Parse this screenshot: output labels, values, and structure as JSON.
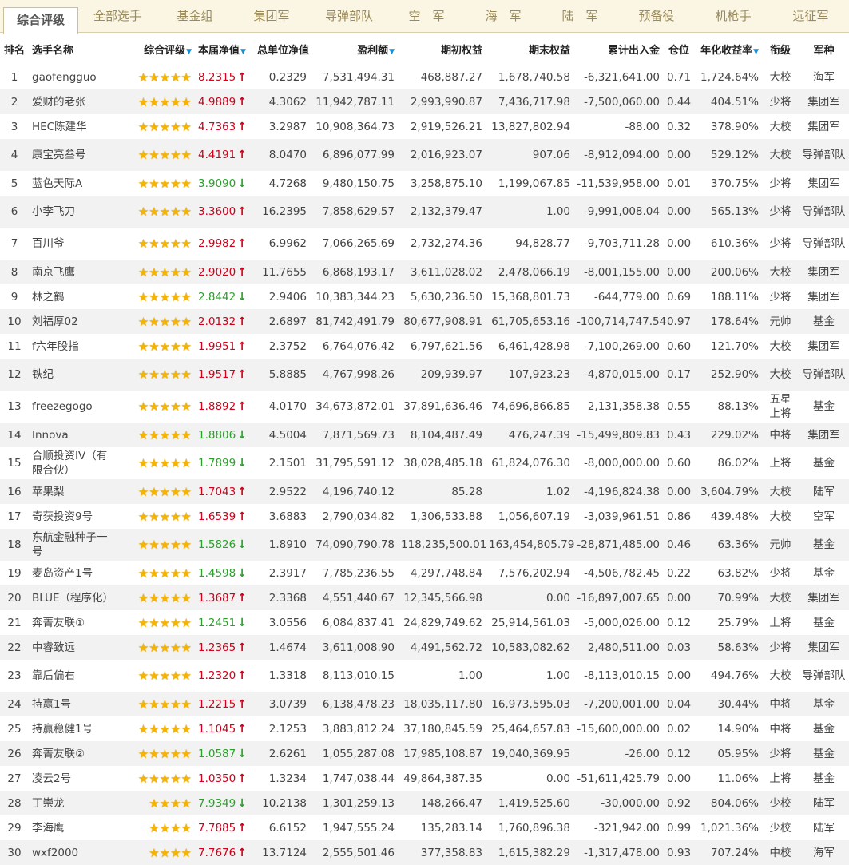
{
  "tabs": [
    "综合评级",
    "全部选手",
    "基金组",
    "集团军",
    "导弹部队",
    "空　军",
    "海　军",
    "陆　军",
    "预备役",
    "机枪手",
    "远征军"
  ],
  "active_tab": 0,
  "colors": {
    "up": "#d0021b",
    "down": "#2ca02c",
    "star": "#f5b400",
    "sort": "#1a8fd0"
  },
  "headers": [
    "排名",
    "选手名称",
    "综合评级",
    "本届净值",
    "总单位净值",
    "盈利额",
    "期初权益",
    "期末权益",
    "累计出入金",
    "仓位",
    "年化收益率",
    "衔级",
    "军种"
  ],
  "sort_indicator": "▼",
  "rows": [
    {
      "rank": "1",
      "name": "gaofengguo",
      "stars": 5,
      "nav": "8.2315",
      "dir": "up",
      "unit": "0.2329",
      "profit": "7,531,494.31",
      "start": "468,887.27",
      "end": "1,678,740.58",
      "flow": "-6,321,641.00",
      "pos": "0.71",
      "ann": "1,724.64%",
      "rankname": "大校",
      "branch": "海军"
    },
    {
      "rank": "2",
      "name": "爱财的老张",
      "stars": 5,
      "nav": "4.9889",
      "dir": "up",
      "unit": "4.3062",
      "profit": "11,942,787.11",
      "start": "2,993,990.87",
      "end": "7,436,717.98",
      "flow": "-7,500,060.00",
      "pos": "0.44",
      "ann": "404.51%",
      "rankname": "少将",
      "branch": "集团军"
    },
    {
      "rank": "3",
      "name": "HEC陈建华",
      "stars": 5,
      "nav": "4.7363",
      "dir": "up",
      "unit": "3.2987",
      "profit": "10,908,364.73",
      "start": "2,919,526.21",
      "end": "13,827,802.94",
      "flow": "-88.00",
      "pos": "0.32",
      "ann": "378.90%",
      "rankname": "大校",
      "branch": "集团军"
    },
    {
      "rank": "4",
      "name": "康宝亮叁号",
      "stars": 5,
      "nav": "4.4191",
      "dir": "up",
      "unit": "8.0470",
      "profit": "6,896,077.99",
      "start": "2,016,923.07",
      "end": "907.06",
      "flow": "-8,912,094.00",
      "pos": "0.00",
      "ann": "529.12%",
      "rankname": "大校",
      "branch": "导弹部队"
    },
    {
      "rank": "5",
      "name": "蓝色天际A",
      "stars": 5,
      "nav": "3.9090",
      "dir": "down",
      "unit": "4.7268",
      "profit": "9,480,150.75",
      "start": "3,258,875.10",
      "end": "1,199,067.85",
      "flow": "-11,539,958.00",
      "pos": "0.01",
      "ann": "370.75%",
      "rankname": "少将",
      "branch": "集团军"
    },
    {
      "rank": "6",
      "name": "小李飞刀",
      "stars": 5,
      "nav": "3.3600",
      "dir": "up",
      "unit": "16.2395",
      "profit": "7,858,629.57",
      "start": "2,132,379.47",
      "end": "1.00",
      "flow": "-9,991,008.04",
      "pos": "0.00",
      "ann": "565.13%",
      "rankname": "少将",
      "branch": "导弹部队"
    },
    {
      "rank": "7",
      "name": "百川爷",
      "stars": 5,
      "nav": "2.9982",
      "dir": "up",
      "unit": "6.9962",
      "profit": "7,066,265.69",
      "start": "2,732,274.36",
      "end": "94,828.77",
      "flow": "-9,703,711.28",
      "pos": "0.00",
      "ann": "610.36%",
      "rankname": "少将",
      "branch": "导弹部队"
    },
    {
      "rank": "8",
      "name": "南京飞鹰",
      "stars": 5,
      "nav": "2.9020",
      "dir": "up",
      "unit": "11.7655",
      "profit": "6,868,193.17",
      "start": "3,611,028.02",
      "end": "2,478,066.19",
      "flow": "-8,001,155.00",
      "pos": "0.00",
      "ann": "200.06%",
      "rankname": "大校",
      "branch": "集团军"
    },
    {
      "rank": "9",
      "name": "林之鹤",
      "stars": 5,
      "nav": "2.8442",
      "dir": "down",
      "unit": "2.9406",
      "profit": "10,383,344.23",
      "start": "5,630,236.50",
      "end": "15,368,801.73",
      "flow": "-644,779.00",
      "pos": "0.69",
      "ann": "188.11%",
      "rankname": "少将",
      "branch": "集团军"
    },
    {
      "rank": "10",
      "name": "刘福厚02",
      "stars": 5,
      "nav": "2.0132",
      "dir": "up",
      "unit": "2.6897",
      "profit": "81,742,491.79",
      "start": "80,677,908.91",
      "end": "61,705,653.16",
      "flow": "-100,714,747.54",
      "pos": "0.97",
      "ann": "178.64%",
      "rankname": "元帅",
      "branch": "基金"
    },
    {
      "rank": "11",
      "name": "f六年股指",
      "stars": 5,
      "nav": "1.9951",
      "dir": "up",
      "unit": "2.3752",
      "profit": "6,764,076.42",
      "start": "6,797,621.56",
      "end": "6,461,428.98",
      "flow": "-7,100,269.00",
      "pos": "0.60",
      "ann": "121.70%",
      "rankname": "大校",
      "branch": "集团军"
    },
    {
      "rank": "12",
      "name": "铁纪",
      "stars": 5,
      "nav": "1.9517",
      "dir": "up",
      "unit": "5.8885",
      "profit": "4,767,998.26",
      "start": "209,939.97",
      "end": "107,923.23",
      "flow": "-4,870,015.00",
      "pos": "0.17",
      "ann": "252.90%",
      "rankname": "大校",
      "branch": "导弹部队"
    },
    {
      "rank": "13",
      "name": "freezegogo",
      "stars": 5,
      "nav": "1.8892",
      "dir": "up",
      "unit": "4.0170",
      "profit": "34,673,872.01",
      "start": "37,891,636.46",
      "end": "74,696,866.85",
      "flow": "2,131,358.38",
      "pos": "0.55",
      "ann": "88.13%",
      "rankname": "五星上将",
      "branch": "基金"
    },
    {
      "rank": "14",
      "name": "Innova",
      "stars": 5,
      "nav": "1.8806",
      "dir": "down",
      "unit": "4.5004",
      "profit": "7,871,569.73",
      "start": "8,104,487.49",
      "end": "476,247.39",
      "flow": "-15,499,809.83",
      "pos": "0.43",
      "ann": "229.02%",
      "rankname": "中将",
      "branch": "集团军"
    },
    {
      "rank": "15",
      "name": "合顺投资IV（有限合伙）",
      "stars": 5,
      "nav": "1.7899",
      "dir": "down",
      "unit": "2.1501",
      "profit": "31,795,591.12",
      "start": "38,028,485.18",
      "end": "61,824,076.30",
      "flow": "-8,000,000.00",
      "pos": "0.60",
      "ann": "86.02%",
      "rankname": "上将",
      "branch": "基金"
    },
    {
      "rank": "16",
      "name": "苹果梨",
      "stars": 5,
      "nav": "1.7043",
      "dir": "up",
      "unit": "2.9522",
      "profit": "4,196,740.12",
      "start": "85.28",
      "end": "1.02",
      "flow": "-4,196,824.38",
      "pos": "0.00",
      "ann": "3,604.79%",
      "rankname": "大校",
      "branch": "陆军"
    },
    {
      "rank": "17",
      "name": "奇获投资9号",
      "stars": 5,
      "nav": "1.6539",
      "dir": "up",
      "unit": "3.6883",
      "profit": "2,790,034.82",
      "start": "1,306,533.88",
      "end": "1,056,607.19",
      "flow": "-3,039,961.51",
      "pos": "0.86",
      "ann": "439.48%",
      "rankname": "大校",
      "branch": "空军"
    },
    {
      "rank": "18",
      "name": "东航金融种子一号",
      "stars": 5,
      "nav": "1.5826",
      "dir": "down",
      "unit": "1.8910",
      "profit": "74,090,790.78",
      "start": "118,235,500.01",
      "end": "163,454,805.79",
      "flow": "-28,871,485.00",
      "pos": "0.46",
      "ann": "63.36%",
      "rankname": "元帅",
      "branch": "基金"
    },
    {
      "rank": "19",
      "name": "麦岛资产1号",
      "stars": 5,
      "nav": "1.4598",
      "dir": "down",
      "unit": "2.3917",
      "profit": "7,785,236.55",
      "start": "4,297,748.84",
      "end": "7,576,202.94",
      "flow": "-4,506,782.45",
      "pos": "0.22",
      "ann": "63.82%",
      "rankname": "少将",
      "branch": "基金"
    },
    {
      "rank": "20",
      "name": "BLUE（程序化）",
      "stars": 5,
      "nav": "1.3687",
      "dir": "up",
      "unit": "2.3368",
      "profit": "4,551,440.67",
      "start": "12,345,566.98",
      "end": "0.00",
      "flow": "-16,897,007.65",
      "pos": "0.00",
      "ann": "70.99%",
      "rankname": "大校",
      "branch": "集团军"
    },
    {
      "rank": "21",
      "name": "奔菁友联①",
      "stars": 5,
      "nav": "1.2451",
      "dir": "down",
      "unit": "3.0556",
      "profit": "6,084,837.41",
      "start": "24,829,749.62",
      "end": "25,914,561.03",
      "flow": "-5,000,026.00",
      "pos": "0.12",
      "ann": "25.79%",
      "rankname": "上将",
      "branch": "基金"
    },
    {
      "rank": "22",
      "name": "中睿致远",
      "stars": 5,
      "nav": "1.2365",
      "dir": "up",
      "unit": "1.4674",
      "profit": "3,611,008.90",
      "start": "4,491,562.72",
      "end": "10,583,082.62",
      "flow": "2,480,511.00",
      "pos": "0.03",
      "ann": "58.63%",
      "rankname": "少将",
      "branch": "集团军"
    },
    {
      "rank": "23",
      "name": "靠后偏右",
      "stars": 5,
      "nav": "1.2320",
      "dir": "up",
      "unit": "1.3318",
      "profit": "8,113,010.15",
      "start": "1.00",
      "end": "1.00",
      "flow": "-8,113,010.15",
      "pos": "0.00",
      "ann": "494.76%",
      "rankname": "大校",
      "branch": "导弹部队"
    },
    {
      "rank": "24",
      "name": "持赢1号",
      "stars": 5,
      "nav": "1.2215",
      "dir": "up",
      "unit": "3.0739",
      "profit": "6,138,478.23",
      "start": "18,035,117.80",
      "end": "16,973,595.03",
      "flow": "-7,200,001.00",
      "pos": "0.04",
      "ann": "30.44%",
      "rankname": "中将",
      "branch": "基金"
    },
    {
      "rank": "25",
      "name": "持赢稳健1号",
      "stars": 5,
      "nav": "1.1045",
      "dir": "up",
      "unit": "2.1253",
      "profit": "3,883,812.24",
      "start": "37,180,845.59",
      "end": "25,464,657.83",
      "flow": "-15,600,000.00",
      "pos": "0.02",
      "ann": "14.90%",
      "rankname": "中将",
      "branch": "基金"
    },
    {
      "rank": "26",
      "name": "奔菁友联②",
      "stars": 5,
      "nav": "1.0587",
      "dir": "down",
      "unit": "2.6261",
      "profit": "1,055,287.08",
      "start": "17,985,108.87",
      "end": "19,040,369.95",
      "flow": "-26.00",
      "pos": "0.12",
      "ann": "05.95%",
      "rankname": "少将",
      "branch": "基金"
    },
    {
      "rank": "27",
      "name": "凌云2号",
      "stars": 5,
      "nav": "1.0350",
      "dir": "up",
      "unit": "1.3234",
      "profit": "1,747,038.44",
      "start": "49,864,387.35",
      "end": "0.00",
      "flow": "-51,611,425.79",
      "pos": "0.00",
      "ann": "11.06%",
      "rankname": "上将",
      "branch": "基金"
    },
    {
      "rank": "28",
      "name": "丁崇龙",
      "stars": 4,
      "nav": "7.9349",
      "dir": "down",
      "unit": "10.2138",
      "profit": "1,301,259.13",
      "start": "148,266.47",
      "end": "1,419,525.60",
      "flow": "-30,000.00",
      "pos": "0.92",
      "ann": "804.06%",
      "rankname": "少校",
      "branch": "陆军"
    },
    {
      "rank": "29",
      "name": "李海鹰",
      "stars": 4,
      "nav": "7.7885",
      "dir": "up",
      "unit": "6.6152",
      "profit": "1,947,555.24",
      "start": "135,283.14",
      "end": "1,760,896.38",
      "flow": "-321,942.00",
      "pos": "0.99",
      "ann": "1,021.36%",
      "rankname": "少校",
      "branch": "陆军"
    },
    {
      "rank": "30",
      "name": "wxf2000",
      "stars": 4,
      "nav": "7.7676",
      "dir": "up",
      "unit": "13.7124",
      "profit": "2,555,501.46",
      "start": "377,358.83",
      "end": "1,615,382.29",
      "flow": "-1,317,478.00",
      "pos": "0.93",
      "ann": "707.24%",
      "rankname": "中校",
      "branch": "海军"
    }
  ]
}
